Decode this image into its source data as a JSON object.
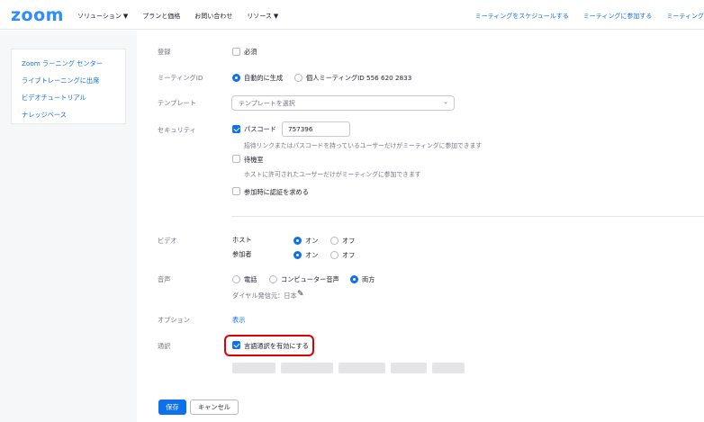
{
  "header": {
    "logo": "zoom",
    "nav": [
      {
        "label": "ソリューション",
        "caret": "▼"
      },
      {
        "label": "プランと価格"
      },
      {
        "label": "お問い合わせ"
      },
      {
        "label": "リソース",
        "caret": "▼"
      }
    ],
    "right_nav": [
      "ミーティングをスケジュールする",
      "ミーティングに参加する",
      "ミーティング"
    ]
  },
  "sidebar": {
    "items": [
      "Zoom ラーニング センター",
      "ライブトレーニングに出席",
      "ビデオチュートリアル",
      "ナレッジベース"
    ]
  },
  "form": {
    "registration": {
      "label": "登録",
      "option": "必須",
      "checked": false
    },
    "meeting_id": {
      "label": "ミーティングID",
      "auto": "自動的に生成",
      "personal": "個人ミーティングID 556 620 2833",
      "selected": "auto"
    },
    "template": {
      "label": "テンプレート",
      "placeholder": "テンプレートを選択"
    },
    "security": {
      "label": "セキュリティ",
      "passcode_label": "パスコード",
      "passcode_value": "757396",
      "passcode_hint": "招待リンクまたはパスコードを持っているユーザーだけがミーティングに参加できます",
      "waiting_room": "待機室",
      "waiting_room_hint": "ホストに許可されたユーザーだけがミーティングに参加できます",
      "auth": "参加時に認証を求める"
    },
    "video": {
      "label": "ビデオ",
      "host": "ホスト",
      "participant": "参加者",
      "on": "オン",
      "off": "オフ",
      "host_value": "on",
      "participant_value": "on"
    },
    "audio": {
      "label": "音声",
      "phone": "電話",
      "computer": "コンピューター音声",
      "both": "両方",
      "selected": "both",
      "dial_in": "ダイヤル発信元：日本",
      "edit_icon": "✎"
    },
    "options": {
      "label": "オプション",
      "link": "表示"
    },
    "interpretation": {
      "label": "通訳",
      "option": "言語通訳を有効にする",
      "checked": true
    }
  },
  "buttons": {
    "save": "保存",
    "cancel": "キャンセル"
  },
  "colors": {
    "accent": "#0e71eb",
    "highlight": "#e10000",
    "logo": "#2d8cff"
  }
}
